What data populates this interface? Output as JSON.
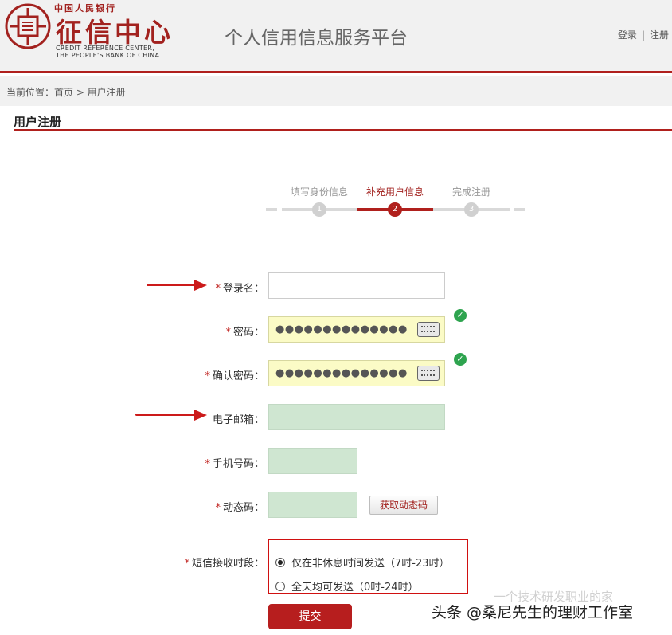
{
  "header": {
    "logo_top": "中国人民银行",
    "logo_main": "征信中心",
    "logo_en_line1": "CREDIT REFERENCE CENTER,",
    "logo_en_line2": "THE PEOPLE'S BANK OF CHINA",
    "platform_title": "个人信用信息服务平台",
    "login_link": "登录",
    "separator": "|",
    "register_link": "注册"
  },
  "breadcrumb": {
    "text": "当前位置：首页 > 用户注册"
  },
  "section": {
    "title": "用户注册"
  },
  "steps": [
    {
      "label": "填写身份信息",
      "number": "1",
      "active": false
    },
    {
      "label": "补充用户信息",
      "number": "2",
      "active": true
    },
    {
      "label": "完成注册",
      "number": "3",
      "active": false
    }
  ],
  "form": {
    "required_mark": "*",
    "login_name": {
      "label": "登录名：",
      "value": ""
    },
    "password": {
      "label": "密码：",
      "value": "●●●●●●●●●●●●●●"
    },
    "confirm_password": {
      "label": "确认密码：",
      "value": "●●●●●●●●●●●●●●"
    },
    "email": {
      "label": "电子邮箱：",
      "value": ""
    },
    "mobile": {
      "label": "手机号码：",
      "value": ""
    },
    "otp": {
      "label": "动态码：",
      "value": "",
      "button": "获取动态码"
    },
    "sms_period": {
      "label": "短信接收时段：",
      "options": [
        {
          "label": "仅在非休息时间发送（7时-23时）",
          "checked": true
        },
        {
          "label": "全天均可发送（0时-24时）",
          "checked": false
        }
      ]
    },
    "submit": "提交"
  },
  "watermark": {
    "faint": "一个技术研发职业的家",
    "main": "头条 @桑尼先生的理财工作室"
  },
  "colors": {
    "brand_red": "#b0201d",
    "valid_green": "#2ea44f",
    "highlight_red": "#d01010"
  }
}
